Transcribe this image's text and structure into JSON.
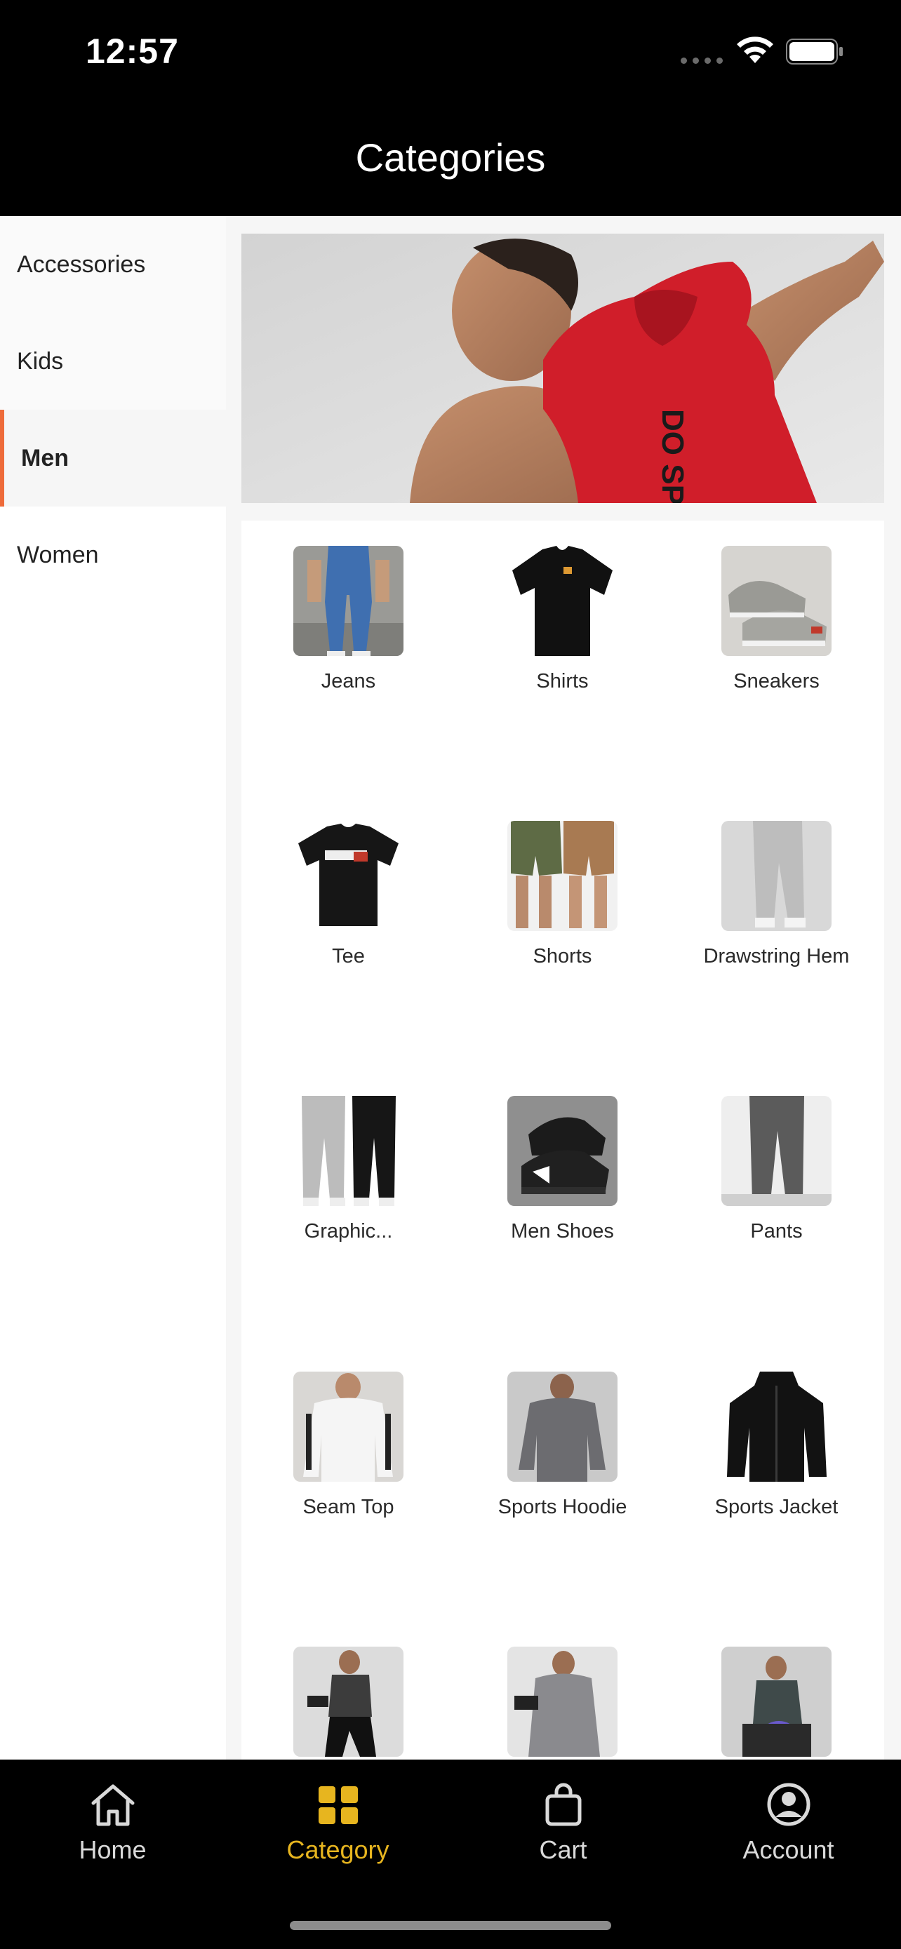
{
  "status_bar": {
    "time": "12:57"
  },
  "header": {
    "title": "Categories"
  },
  "sidebar": {
    "items": [
      {
        "label": "Accessories"
      },
      {
        "label": "Kids"
      },
      {
        "label": "Men"
      },
      {
        "label": "Women"
      }
    ],
    "active": "Men"
  },
  "grid": {
    "items": [
      {
        "label": "Jeans"
      },
      {
        "label": "Shirts"
      },
      {
        "label": "Sneakers"
      },
      {
        "label": "Tee"
      },
      {
        "label": "Shorts"
      },
      {
        "label": "Drawstring Hem"
      },
      {
        "label": "Graphic..."
      },
      {
        "label": "Men Shoes"
      },
      {
        "label": "Pants"
      },
      {
        "label": "Seam Top"
      },
      {
        "label": "Sports Hoodie"
      },
      {
        "label": "Sports Jacket"
      },
      {
        "label": ""
      },
      {
        "label": ""
      },
      {
        "label": ""
      }
    ]
  },
  "tabbar": {
    "items": [
      {
        "label": "Home",
        "icon": "home-icon"
      },
      {
        "label": "Category",
        "icon": "category-grid-icon"
      },
      {
        "label": "Cart",
        "icon": "shopping-bag-icon"
      },
      {
        "label": "Account",
        "icon": "account-icon"
      }
    ],
    "active": "Category",
    "active_color": "#e7b51f"
  },
  "accent_color": "#ee6b3a"
}
